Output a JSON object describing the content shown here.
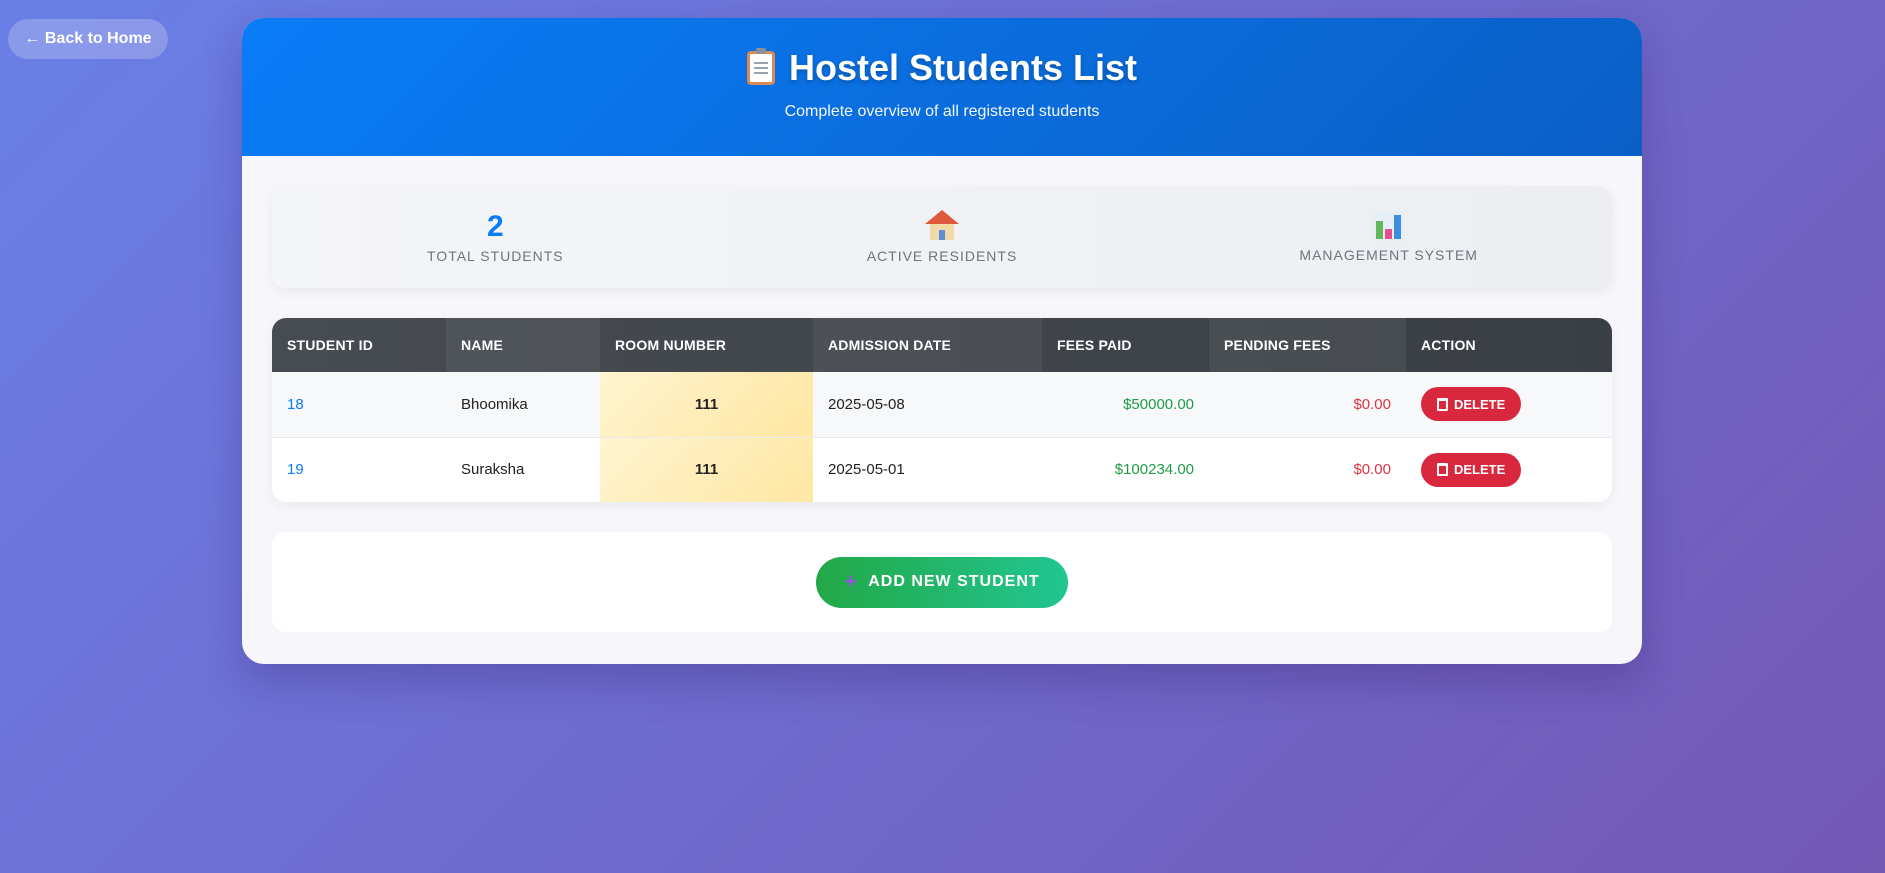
{
  "nav": {
    "back_label": "← Back to Home"
  },
  "header": {
    "title": "Hostel Students List",
    "subtitle": "Complete overview of all registered students",
    "icon": "clipboard-icon"
  },
  "stats": [
    {
      "value": "2",
      "label": "TOTAL STUDENTS"
    },
    {
      "icon": "house-icon",
      "label": "ACTIVE RESIDENTS"
    },
    {
      "icon": "bar-chart-icon",
      "label": "MANAGEMENT SYSTEM"
    }
  ],
  "table": {
    "columns": [
      "STUDENT ID",
      "NAME",
      "ROOM NUMBER",
      "ADMISSION DATE",
      "FEES PAID",
      "PENDING FEES",
      "ACTION"
    ],
    "rows": [
      {
        "id": "18",
        "name": "Bhoomika",
        "room": "111",
        "admission": "2025-05-08",
        "fees_paid": "$50000.00",
        "pending": "$0.00",
        "action": "DELETE"
      },
      {
        "id": "19",
        "name": "Suraksha",
        "room": "111",
        "admission": "2025-05-01",
        "fees_paid": "$100234.00",
        "pending": "$0.00",
        "action": "DELETE"
      }
    ]
  },
  "add_button": {
    "label": "ADD NEW STUDENT",
    "icon": "plus-icon"
  },
  "colors": {
    "accent": "#0a7cf7",
    "success": "#1f9d44",
    "danger": "#dc3545",
    "header_dark": "#3a3f45"
  }
}
